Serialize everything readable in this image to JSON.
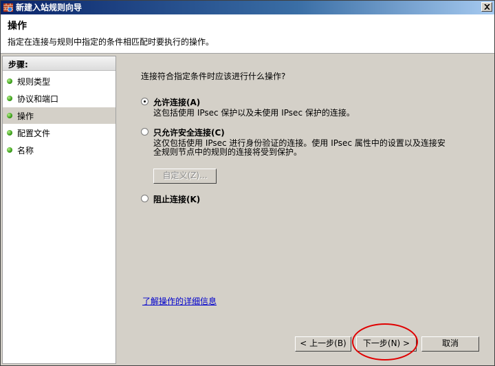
{
  "window": {
    "title": "新建入站规则向导",
    "icons": {
      "app": "firewall-icon",
      "close": "close-icon"
    }
  },
  "header": {
    "title": "操作",
    "subtitle": "指定在连接与规则中指定的条件相匹配时要执行的操作。"
  },
  "steps": {
    "heading": "步骤:",
    "items": [
      {
        "label": "规则类型",
        "active": false
      },
      {
        "label": "协议和端口",
        "active": false
      },
      {
        "label": "操作",
        "active": true
      },
      {
        "label": "配置文件",
        "active": false
      },
      {
        "label": "名称",
        "active": false
      }
    ]
  },
  "content": {
    "question": "连接符合指定条件时应该进行什么操作?",
    "options": [
      {
        "label": "允许连接(A)",
        "desc": [
          "这包括使用 IPsec 保护以及未使用 IPsec 保护的连接。"
        ],
        "selected": true
      },
      {
        "label": "只允许安全连接(C)",
        "desc": [
          "这仅包括使用 IPsec 进行身份验证的连接。使用 IPsec 属性中的设置以及连接安",
          "全规则节点中的规则的连接将受到保护。"
        ],
        "selected": false
      },
      {
        "label": "阻止连接(K)",
        "desc": [],
        "selected": false
      }
    ],
    "customize_label": "自定义(Z)...",
    "learn_more_link": "了解操作的详细信息"
  },
  "footer": {
    "back_label": "< 上一步(B)",
    "next_label": "下一步(N) >",
    "cancel_label": "取消"
  },
  "colors": {
    "annotation": "#e00000",
    "link": "#0000cc",
    "step_dot": "#3b9f1a"
  }
}
